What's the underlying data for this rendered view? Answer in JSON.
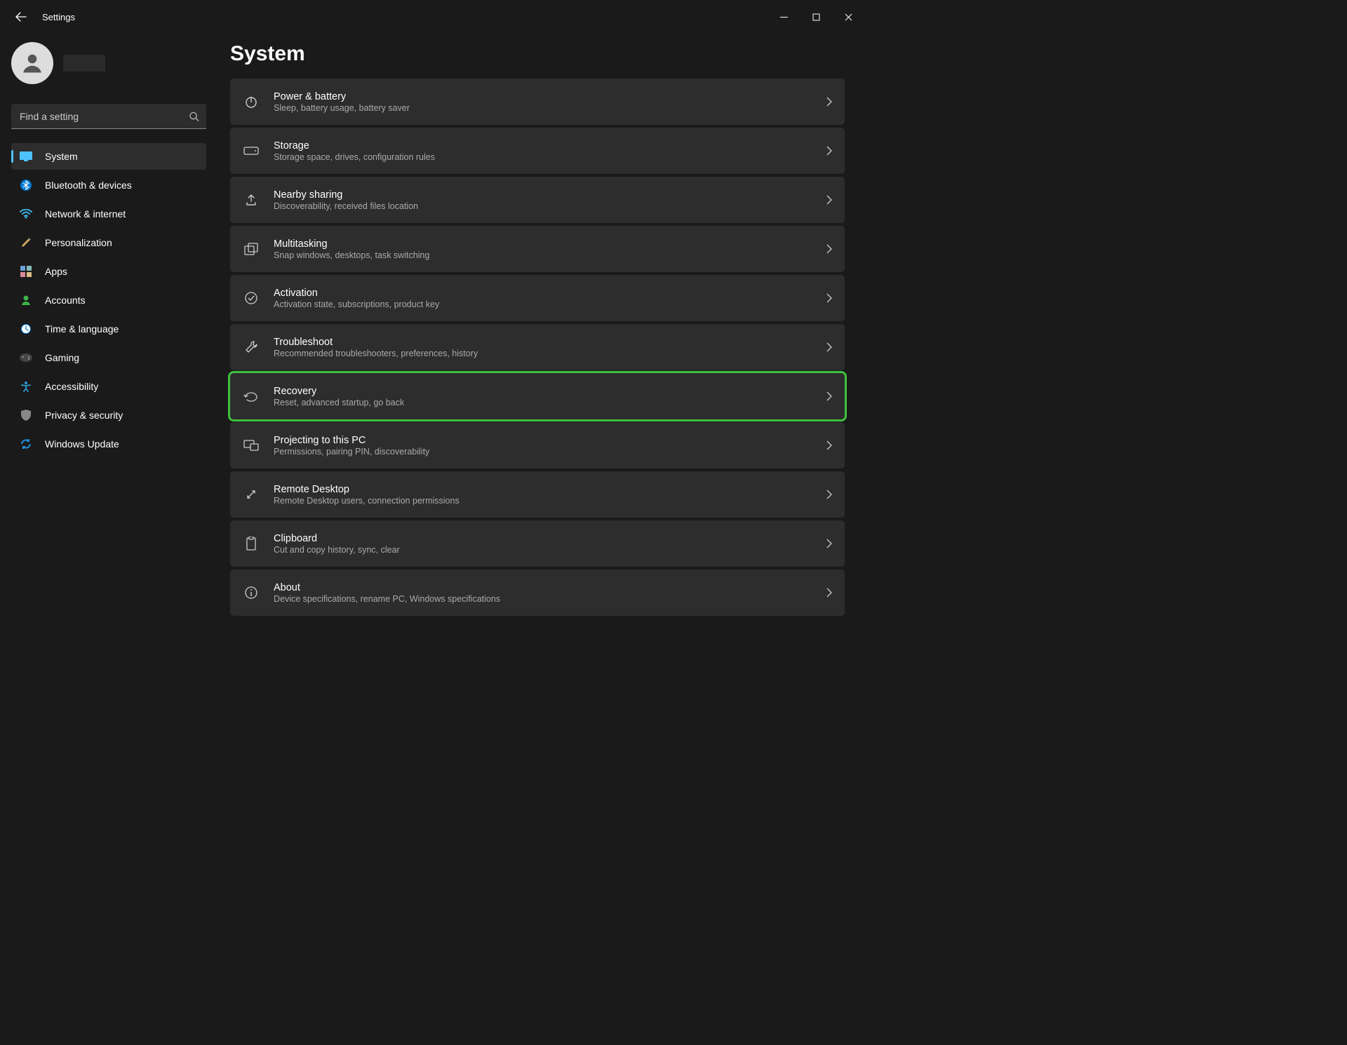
{
  "window": {
    "title": "Settings"
  },
  "search": {
    "placeholder": "Find a setting"
  },
  "nav": {
    "items": [
      {
        "label": "System"
      },
      {
        "label": "Bluetooth & devices"
      },
      {
        "label": "Network & internet"
      },
      {
        "label": "Personalization"
      },
      {
        "label": "Apps"
      },
      {
        "label": "Accounts"
      },
      {
        "label": "Time & language"
      },
      {
        "label": "Gaming"
      },
      {
        "label": "Accessibility"
      },
      {
        "label": "Privacy & security"
      },
      {
        "label": "Windows Update"
      }
    ]
  },
  "page": {
    "title": "System"
  },
  "cards": [
    {
      "title": "Power & battery",
      "sub": "Sleep, battery usage, battery saver"
    },
    {
      "title": "Storage",
      "sub": "Storage space, drives, configuration rules"
    },
    {
      "title": "Nearby sharing",
      "sub": "Discoverability, received files location"
    },
    {
      "title": "Multitasking",
      "sub": "Snap windows, desktops, task switching"
    },
    {
      "title": "Activation",
      "sub": "Activation state, subscriptions, product key"
    },
    {
      "title": "Troubleshoot",
      "sub": "Recommended troubleshooters, preferences, history"
    },
    {
      "title": "Recovery",
      "sub": "Reset, advanced startup, go back"
    },
    {
      "title": "Projecting to this PC",
      "sub": "Permissions, pairing PIN, discoverability"
    },
    {
      "title": "Remote Desktop",
      "sub": "Remote Desktop users, connection permissions"
    },
    {
      "title": "Clipboard",
      "sub": "Cut and copy history, sync, clear"
    },
    {
      "title": "About",
      "sub": "Device specifications, rename PC, Windows specifications"
    }
  ]
}
